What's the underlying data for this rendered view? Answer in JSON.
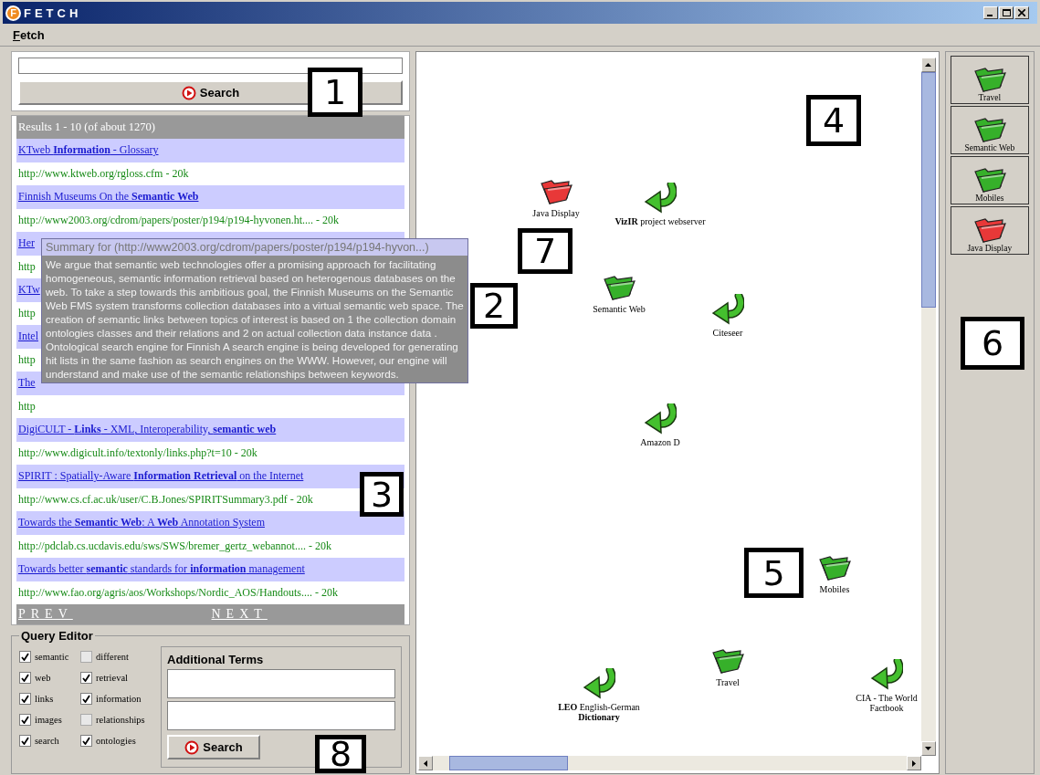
{
  "window": {
    "logo_letter": "F",
    "title": "FETCH"
  },
  "menu": [
    "Fetch"
  ],
  "search": {
    "button": "Search"
  },
  "results": {
    "header": "Results 1 - 10 (of about 1270)",
    "items": [
      {
        "title": "KTweb **Information** - Glossary",
        "url": "http://www.ktweb.org/rgloss.cfm - 20k"
      },
      {
        "title": "Finnish Museums On the **Semantic Web**",
        "url": "http://www2003.org/cdrom/papers/poster/p194/p194-hyvonen.ht.... - 20k"
      },
      {
        "title": "Her",
        "url": "http"
      },
      {
        "title": "KTw",
        "url": "http"
      },
      {
        "title": "Intel",
        "url": "http"
      },
      {
        "title": "The",
        "url": "http"
      },
      {
        "title": "DigiCULT - **Links** - XML, Interoperability, **semantic web**",
        "url": "http://www.digicult.info/textonly/links.php?t=10 - 20k"
      },
      {
        "title": "SPIRIT : Spatially-Aware **Information Retrieval** on the Internet",
        "url": "http://www.cs.cf.ac.uk/user/C.B.Jones/SPIRITSummary3.pdf - 20k"
      },
      {
        "title": "Towards the **Semantic Web**: A **Web** Annotation System",
        "url": "http://pdclab.cs.ucdavis.edu/sws/SWS/bremer_gertz_webannot.... - 20k"
      },
      {
        "title": "Towards better **semantic** standards for **information** management",
        "url": "http://www.fao.org/agris/aos/Workshops/Nordic_AOS/Handouts.... - 20k"
      }
    ],
    "prev": "PREV",
    "next": "NEXT"
  },
  "tooltip": {
    "header": "Summary for (http://www2003.org/cdrom/papers/poster/p194/p194-hyvon...)",
    "body": "We argue that semantic web technologies offer a promising approach for facilitating homogeneous, semantic information retrieval based on heterogenous databases on the web. To take a step towards this ambitious goal, the Finnish Museums on the Semantic Web FMS system transforms collection databases into a virtual semantic web space. The creation of semantic links between topics of interest is based on 1 the collection domain ontologies classes and their relations and 2 on actual collection data instance data . Ontological search engine for Finnish A search engine is being developed for generating hit lists in the same fashion as search engines on the WWW. However, our engine will understand and make use of the semantic relationships between keywords."
  },
  "query_editor": {
    "title": "Query Editor",
    "terms": [
      {
        "label": "semantic",
        "checked": true
      },
      {
        "label": "different",
        "checked": false
      },
      {
        "label": "web",
        "checked": true
      },
      {
        "label": "retrieval",
        "checked": true
      },
      {
        "label": "links",
        "checked": true
      },
      {
        "label": "information",
        "checked": true
      },
      {
        "label": "images",
        "checked": true
      },
      {
        "label": "relationships",
        "checked": false
      },
      {
        "label": "search",
        "checked": true
      },
      {
        "label": "ontologies",
        "checked": true
      }
    ],
    "additional_terms": {
      "title": "Additional Terms",
      "button": "Search"
    }
  },
  "canvas": {
    "nodes": [
      {
        "kind": "folder",
        "label": "Java Display",
        "color": "#e83838"
      },
      {
        "kind": "link",
        "label": "**VizIR** project webserver"
      },
      {
        "kind": "folder",
        "label": "Semantic Web",
        "color": "#36b02a"
      },
      {
        "kind": "link",
        "label": "Citeseer"
      },
      {
        "kind": "link",
        "label": "Amazon D"
      },
      {
        "kind": "folder",
        "label": "Mobiles",
        "color": "#36b02a"
      },
      {
        "kind": "folder",
        "label": "Travel",
        "color": "#36b02a"
      },
      {
        "kind": "link",
        "label": "**LEO** English-German **Dictionary**"
      },
      {
        "kind": "link",
        "label": "CIA - The World Factbook"
      }
    ]
  },
  "sidebar": {
    "items": [
      {
        "label": "Travel",
        "color": "#36b02a"
      },
      {
        "label": "Semantic Web",
        "color": "#36b02a"
      },
      {
        "label": "Mobiles",
        "color": "#36b02a"
      },
      {
        "label": "Java Display",
        "color": "#e83838"
      }
    ]
  },
  "callouts": [
    "1",
    "2",
    "3",
    "4",
    "5",
    "6",
    "7",
    "8"
  ]
}
